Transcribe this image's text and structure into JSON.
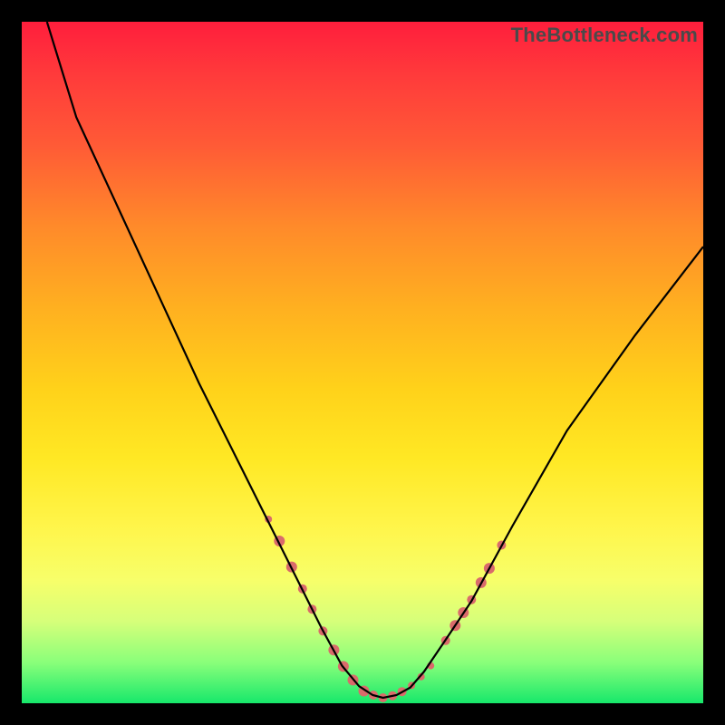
{
  "watermark": "TheBottleneck.com",
  "chart_data": {
    "type": "line",
    "title": "",
    "xlabel": "",
    "ylabel": "",
    "xlim": [
      0,
      100
    ],
    "ylim": [
      0,
      100
    ],
    "gradient_stops": [
      {
        "pct": 0,
        "color": "#ff1e3c"
      },
      {
        "pct": 8,
        "color": "#ff3b3b"
      },
      {
        "pct": 18,
        "color": "#ff5a36"
      },
      {
        "pct": 30,
        "color": "#ff8a2a"
      },
      {
        "pct": 42,
        "color": "#ffb020"
      },
      {
        "pct": 54,
        "color": "#ffd21a"
      },
      {
        "pct": 64,
        "color": "#ffe824"
      },
      {
        "pct": 74,
        "color": "#fff54a"
      },
      {
        "pct": 82,
        "color": "#f7ff6a"
      },
      {
        "pct": 88,
        "color": "#d6ff7a"
      },
      {
        "pct": 94,
        "color": "#8aff7a"
      },
      {
        "pct": 100,
        "color": "#17e86b"
      }
    ],
    "series": [
      {
        "name": "bottleneck-curve",
        "stroke": "#000000",
        "x": [
          3.7,
          8,
          14,
          20,
          26,
          32,
          36,
          40,
          44,
          47,
          49.5,
          51.5,
          53,
          55,
          57,
          59,
          62,
          66,
          72,
          80,
          90,
          100
        ],
        "y": [
          100,
          86,
          73,
          60,
          47,
          35,
          27,
          19,
          11,
          5.5,
          2.5,
          1.2,
          0.8,
          1.2,
          2.3,
          4.6,
          9,
          15,
          26,
          40,
          54,
          67
        ]
      }
    ],
    "scatter": [
      {
        "name": "curve-markers",
        "color": "#d96b6b",
        "points": [
          {
            "x": 36.2,
            "y": 27.0,
            "r": 4
          },
          {
            "x": 37.8,
            "y": 23.8,
            "r": 6
          },
          {
            "x": 39.6,
            "y": 20.0,
            "r": 6
          },
          {
            "x": 41.2,
            "y": 16.8,
            "r": 5
          },
          {
            "x": 42.6,
            "y": 13.8,
            "r": 5
          },
          {
            "x": 44.2,
            "y": 10.6,
            "r": 5
          },
          {
            "x": 45.8,
            "y": 7.8,
            "r": 6
          },
          {
            "x": 47.2,
            "y": 5.4,
            "r": 6
          },
          {
            "x": 48.6,
            "y": 3.4,
            "r": 6
          },
          {
            "x": 50.2,
            "y": 1.8,
            "r": 6
          },
          {
            "x": 51.6,
            "y": 1.2,
            "r": 5
          },
          {
            "x": 53.0,
            "y": 0.8,
            "r": 5
          },
          {
            "x": 54.4,
            "y": 1.1,
            "r": 5
          },
          {
            "x": 55.8,
            "y": 1.7,
            "r": 5
          },
          {
            "x": 57.2,
            "y": 2.6,
            "r": 4
          },
          {
            "x": 58.6,
            "y": 3.9,
            "r": 4
          },
          {
            "x": 60.0,
            "y": 5.5,
            "r": 4
          },
          {
            "x": 62.2,
            "y": 9.2,
            "r": 5
          },
          {
            "x": 63.6,
            "y": 11.4,
            "r": 6
          },
          {
            "x": 64.8,
            "y": 13.3,
            "r": 6
          },
          {
            "x": 66.0,
            "y": 15.2,
            "r": 5
          },
          {
            "x": 67.4,
            "y": 17.7,
            "r": 6
          },
          {
            "x": 68.6,
            "y": 19.8,
            "r": 6
          },
          {
            "x": 70.4,
            "y": 23.2,
            "r": 5
          }
        ]
      }
    ]
  }
}
